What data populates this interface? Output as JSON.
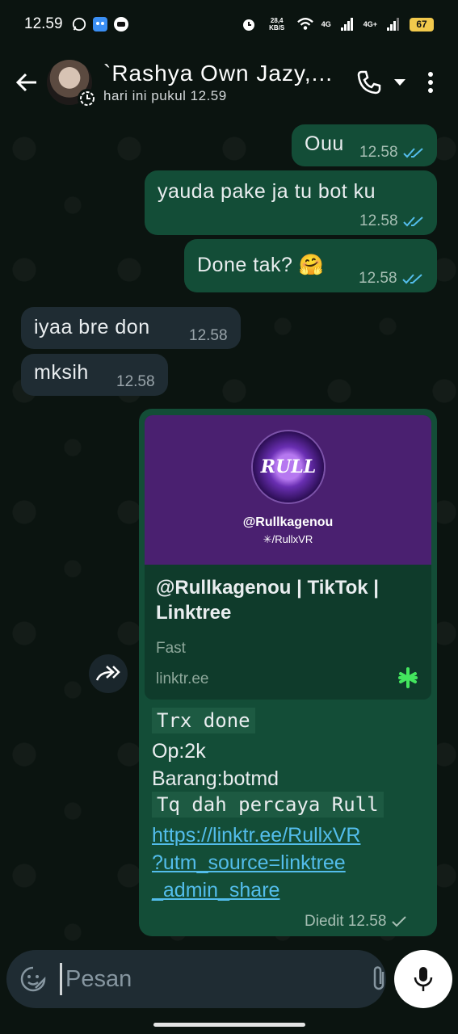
{
  "status_bar": {
    "time": "12.59",
    "net_speed": "28,4 KB/S",
    "signal1": "4G",
    "signal2": "4G+",
    "battery": "67"
  },
  "header": {
    "title": "`Rashya Own Jazy,...",
    "subtitle": "hari ini pukul 12.59"
  },
  "messages": [
    {
      "dir": "out",
      "text": "Ouu",
      "time": "12.58"
    },
    {
      "dir": "out",
      "text": "yauda pake ja tu bot ku",
      "time": "12.58"
    },
    {
      "dir": "out",
      "text": "Done tak? 🤗",
      "time": "12.58"
    },
    {
      "dir": "in",
      "text": "iyaa bre don",
      "time": "12.58"
    },
    {
      "dir": "in",
      "text": "mksih",
      "time": "12.58"
    }
  ],
  "link_message": {
    "preview": {
      "logo_text": "RULL",
      "image_handle": "@Rullkagenou",
      "image_sub": "✳/RullxVR",
      "title": "@Rullkagenou | TikTok | Linktree",
      "description": "Fast",
      "domain": "linktr.ee"
    },
    "line1": "Trx done",
    "line2": "Op:2k",
    "line3": "Barang:botmd",
    "line4": "Tq dah percaya Rull",
    "link_lines": [
      "https://linktr.ee/RullxVR",
      "?utm_source=linktree",
      "_admin_share"
    ],
    "meta": "Diedit 12.58"
  },
  "composer": {
    "placeholder": "Pesan"
  },
  "colors": {
    "outgoing_bubble": "#134d37",
    "incoming_bubble": "#1f2c33",
    "read_ticks": "#53bdeb",
    "link": "#53bdeb"
  },
  "icons": [
    "back-arrow-icon",
    "status-ring-icon",
    "phone-icon",
    "chevron-down-icon",
    "more-vert-icon",
    "read-receipt-icon",
    "forward-icon",
    "linktree-icon",
    "sticker-icon",
    "attach-icon",
    "camera-icon",
    "mic-icon"
  ]
}
